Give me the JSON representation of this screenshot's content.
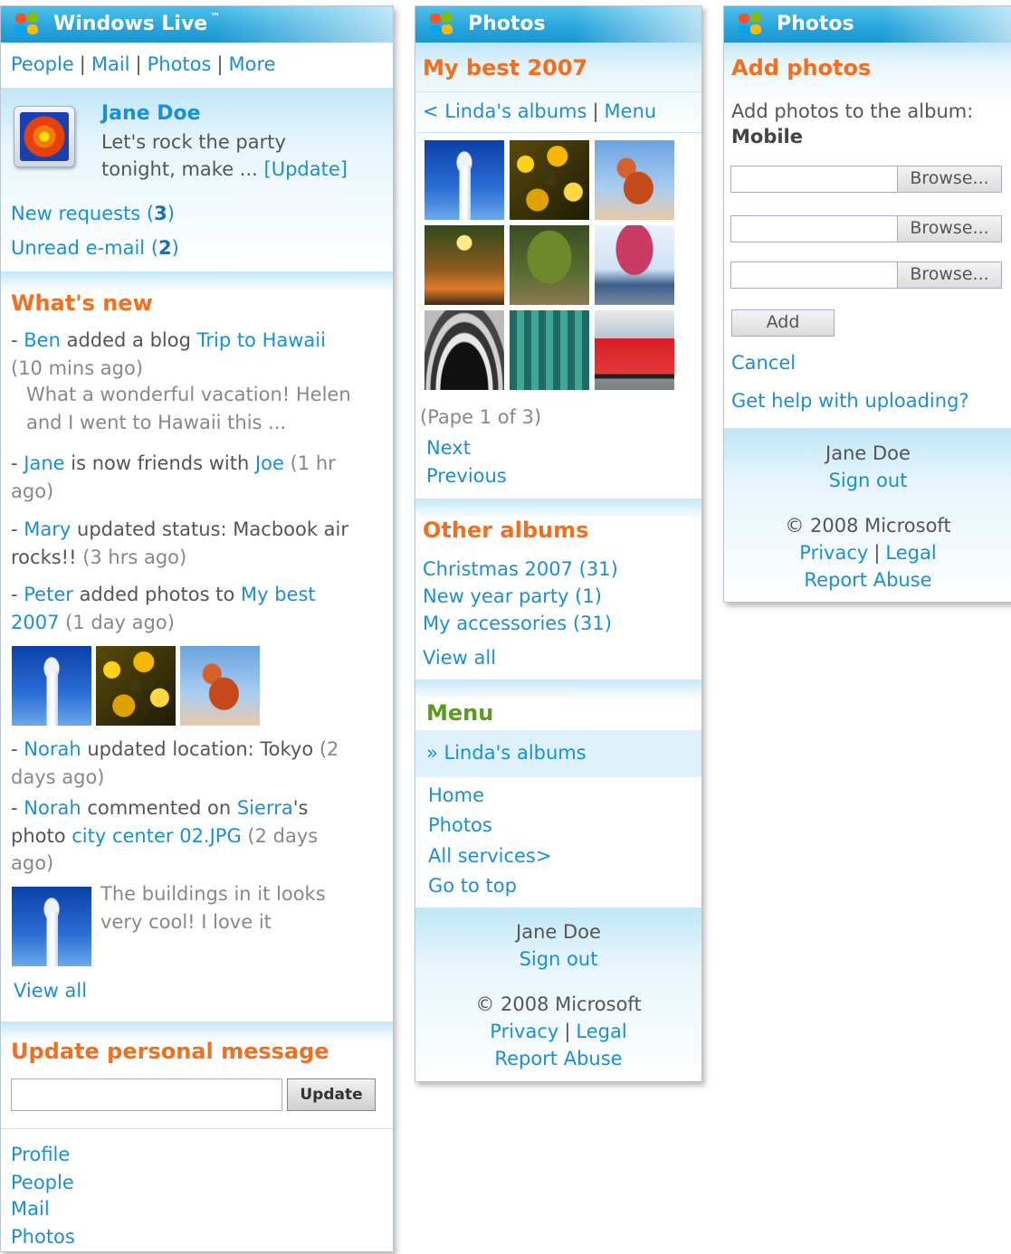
{
  "brand_colors": {
    "link": "#1a8fd6",
    "heading": "#f26f1e",
    "menu_heading": "#5b9a1c",
    "titlebar": "#2aa6dc"
  },
  "panel1": {
    "title": "Windows Live",
    "trademark": "™",
    "nav": [
      "People",
      "Mail",
      "Photos",
      "More"
    ],
    "nav_separator": "|",
    "profile": {
      "name": "Jane Doe",
      "message_line1": "Let's rock the party",
      "message_line2": "tonight, make ...",
      "update_link": "[Update]"
    },
    "requests": {
      "label": "New requests (",
      "count": "3",
      "close": ")"
    },
    "unread": {
      "label": "Unread e-mail (",
      "count": "2",
      "close": ")"
    },
    "whats_new_title": "What's new",
    "feed": {
      "f1": {
        "dash": "- ",
        "who": "Ben",
        "action": " added a blog ",
        "link": "Trip to Hawaii",
        "time": "(10 mins ago)",
        "excerpt1": "What a wonderful vacation! Helen",
        "excerpt2": "and I went to Hawaii this ..."
      },
      "f2": {
        "dash": "- ",
        "who": "Jane",
        "action": " is now friends with ",
        "link": "Joe",
        "time1": " (1 hr",
        "time2": "ago)"
      },
      "f3": {
        "dash": "- ",
        "who": "Mary",
        "action": " updated status: Macbook air",
        "action2": "rocks!!",
        "time": " (3 hrs ago)"
      },
      "f4": {
        "dash": "- ",
        "who": "Peter",
        "action": " added photos to ",
        "link1": "My best",
        "link2": "2007",
        "time": " (1 day ago)"
      },
      "f5": {
        "dash": "- ",
        "who": "Norah",
        "action": " updated location: Tokyo",
        "time1": " (2",
        "time2": "days ago)"
      },
      "f6": {
        "dash": "- ",
        "who": "Norah",
        "action": " commented on ",
        "link": "Sierra",
        "possessive": "'s",
        "action2": "photo ",
        "file": "city center 02.JPG",
        "time1": " (2 days",
        "time2": "ago)",
        "comment1": "The buildings in it looks",
        "comment2": "very cool! I love it"
      }
    },
    "view_all": "View all",
    "update_title": "Update personal message",
    "update_input_value": "",
    "update_button": "Update",
    "bottom_links": [
      "Profile",
      "People",
      "Mail",
      "Photos"
    ]
  },
  "panel2": {
    "title": "Photos",
    "album_title": "My best 2007",
    "nav_back": "< Linda's albums",
    "nav_menu": "Menu",
    "page_info": "(Pape 1 of 3)",
    "next": "Next",
    "previous": "Previous",
    "other_albums_title": "Other albums",
    "albums": [
      "Christmas 2007 (31)",
      "New year party (1)",
      "My accessories (31)"
    ],
    "view_all": "View all",
    "menu_title": "Menu",
    "menu_highlight": "» Linda's albums",
    "menu_items": [
      "Home",
      "Photos",
      "All services>",
      "Go to top"
    ],
    "footer": {
      "user": "Jane Doe",
      "sign_out": "Sign out",
      "copyright": "© 2008 Microsoft",
      "privacy": "Privacy",
      "legal": "Legal",
      "report": "Report Abuse"
    }
  },
  "panel3": {
    "title": "Photos",
    "heading": "Add photos",
    "prompt": "Add photos to the album:",
    "album": "Mobile",
    "browse_label": "Browse...",
    "add_button": "Add",
    "cancel": "Cancel",
    "help": "Get help with uploading?",
    "footer": {
      "user": "Jane Doe",
      "sign_out": "Sign out",
      "copyright": "© 2008 Microsoft",
      "privacy": "Privacy",
      "legal": "Legal",
      "report": "Report Abuse"
    }
  }
}
